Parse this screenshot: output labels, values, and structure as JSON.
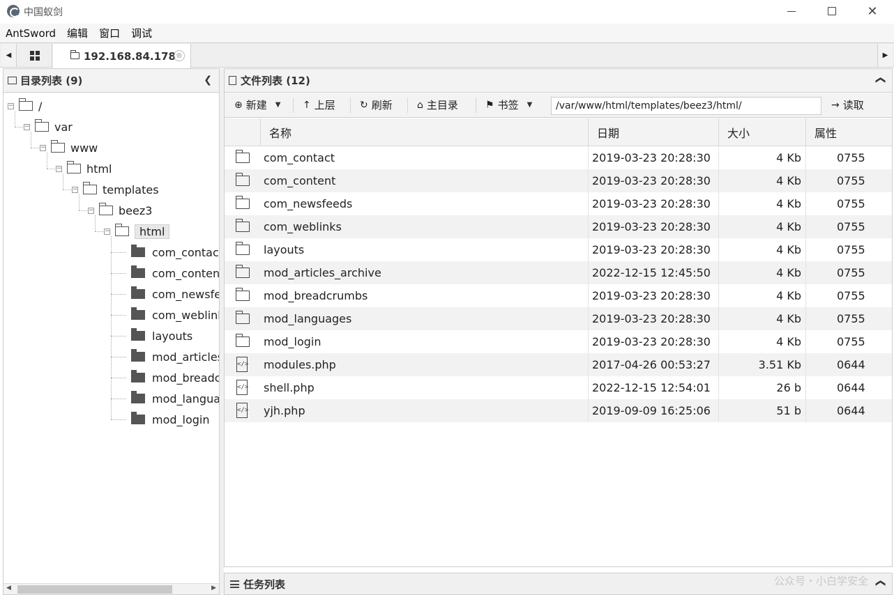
{
  "window": {
    "title": "中国蚁剑",
    "minimize": "—",
    "close": "✕"
  },
  "menu": [
    "AntSword",
    "编辑",
    "窗口",
    "调试"
  ],
  "tabs": {
    "host": "192.168.84.178",
    "close": "⊗",
    "left_arrow": "◀",
    "right_arrow": "▶"
  },
  "left_panel": {
    "title": "目录列表 (9)",
    "collapse": "❮",
    "tree": [
      {
        "label": "/",
        "depth": 0,
        "expanded": true
      },
      {
        "label": "var",
        "depth": 1,
        "expanded": true
      },
      {
        "label": "www",
        "depth": 2,
        "expanded": true
      },
      {
        "label": "html",
        "depth": 3,
        "expanded": true
      },
      {
        "label": "templates",
        "depth": 4,
        "expanded": true
      },
      {
        "label": "beez3",
        "depth": 5,
        "expanded": true
      },
      {
        "label": "html",
        "depth": 6,
        "expanded": true,
        "selected": true
      },
      {
        "label": "com_contact",
        "depth": 7
      },
      {
        "label": "com_content",
        "depth": 7
      },
      {
        "label": "com_newsfeeds",
        "depth": 7
      },
      {
        "label": "com_weblinks",
        "depth": 7
      },
      {
        "label": "layouts",
        "depth": 7
      },
      {
        "label": "mod_articles_archive",
        "depth": 7
      },
      {
        "label": "mod_breadcrumbs",
        "depth": 7
      },
      {
        "label": "mod_languages",
        "depth": 7
      },
      {
        "label": "mod_login",
        "depth": 7
      }
    ],
    "scroll": {
      "left": "◀",
      "right": "▶"
    }
  },
  "right_panel": {
    "title": "文件列表 (12)",
    "collapse": "❮",
    "toolbar": {
      "new": "新建",
      "up": "上层",
      "refresh": "刷新",
      "home": "主目录",
      "bookmark": "书签",
      "path": "/var/www/html/templates/beez3/html/",
      "read": "读取",
      "caret": "▼"
    },
    "columns": {
      "name": "名称",
      "date": "日期",
      "size": "大小",
      "perm": "属性"
    },
    "files": [
      {
        "type": "folder",
        "name": "com_contact",
        "date": "2019-03-23 20:28:30",
        "size": "4 Kb",
        "perm": "0755"
      },
      {
        "type": "folder",
        "name": "com_content",
        "date": "2019-03-23 20:28:30",
        "size": "4 Kb",
        "perm": "0755"
      },
      {
        "type": "folder",
        "name": "com_newsfeeds",
        "date": "2019-03-23 20:28:30",
        "size": "4 Kb",
        "perm": "0755"
      },
      {
        "type": "folder",
        "name": "com_weblinks",
        "date": "2019-03-23 20:28:30",
        "size": "4 Kb",
        "perm": "0755"
      },
      {
        "type": "folder",
        "name": "layouts",
        "date": "2019-03-23 20:28:30",
        "size": "4 Kb",
        "perm": "0755"
      },
      {
        "type": "folder",
        "name": "mod_articles_archive",
        "date": "2022-12-15 12:45:50",
        "size": "4 Kb",
        "perm": "0755"
      },
      {
        "type": "folder",
        "name": "mod_breadcrumbs",
        "date": "2019-03-23 20:28:30",
        "size": "4 Kb",
        "perm": "0755"
      },
      {
        "type": "folder",
        "name": "mod_languages",
        "date": "2019-03-23 20:28:30",
        "size": "4 Kb",
        "perm": "0755"
      },
      {
        "type": "folder",
        "name": "mod_login",
        "date": "2019-03-23 20:28:30",
        "size": "4 Kb",
        "perm": "0755"
      },
      {
        "type": "file",
        "name": "modules.php",
        "date": "2017-04-26 00:53:27",
        "size": "3.51 Kb",
        "perm": "0644"
      },
      {
        "type": "file",
        "name": "shell.php",
        "date": "2022-12-15 12:54:01",
        "size": "26 b",
        "perm": "0644"
      },
      {
        "type": "file",
        "name": "yjh.php",
        "date": "2019-09-09 16:25:06",
        "size": "51 b",
        "perm": "0644"
      }
    ]
  },
  "task_panel": {
    "title": "任务列表",
    "collapse": "❮"
  },
  "watermark": "公众号・小白学安全"
}
